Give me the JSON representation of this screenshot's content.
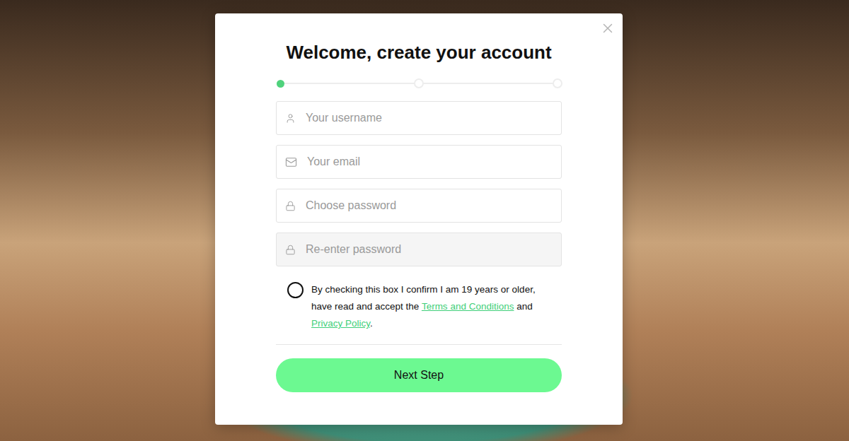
{
  "dialog": {
    "title": "Welcome, create your account"
  },
  "steps": [
    {
      "selected": true
    },
    {
      "selected": false
    },
    {
      "selected": false
    }
  ],
  "fields": [
    {
      "kind": "username",
      "placeholder": "Your username",
      "disabled": false
    },
    {
      "kind": "email",
      "placeholder": "Your email",
      "disabled": false
    },
    {
      "kind": "password",
      "placeholder": "Choose password",
      "disabled": false
    },
    {
      "kind": "password",
      "placeholder": "Re-enter password",
      "disabled": true
    }
  ],
  "consent": {
    "checked": false,
    "segments": [
      {
        "text": "By checking this box I confirm I am 19 years or older, have read and accept the ",
        "link": false
      },
      {
        "text": "Terms and Conditions",
        "link": true
      },
      {
        "text": " and ",
        "link": false
      },
      {
        "text": "Privacy Policy",
        "link": true
      },
      {
        "text": ".",
        "link": false
      }
    ]
  },
  "button": {
    "label": "Next Step"
  }
}
